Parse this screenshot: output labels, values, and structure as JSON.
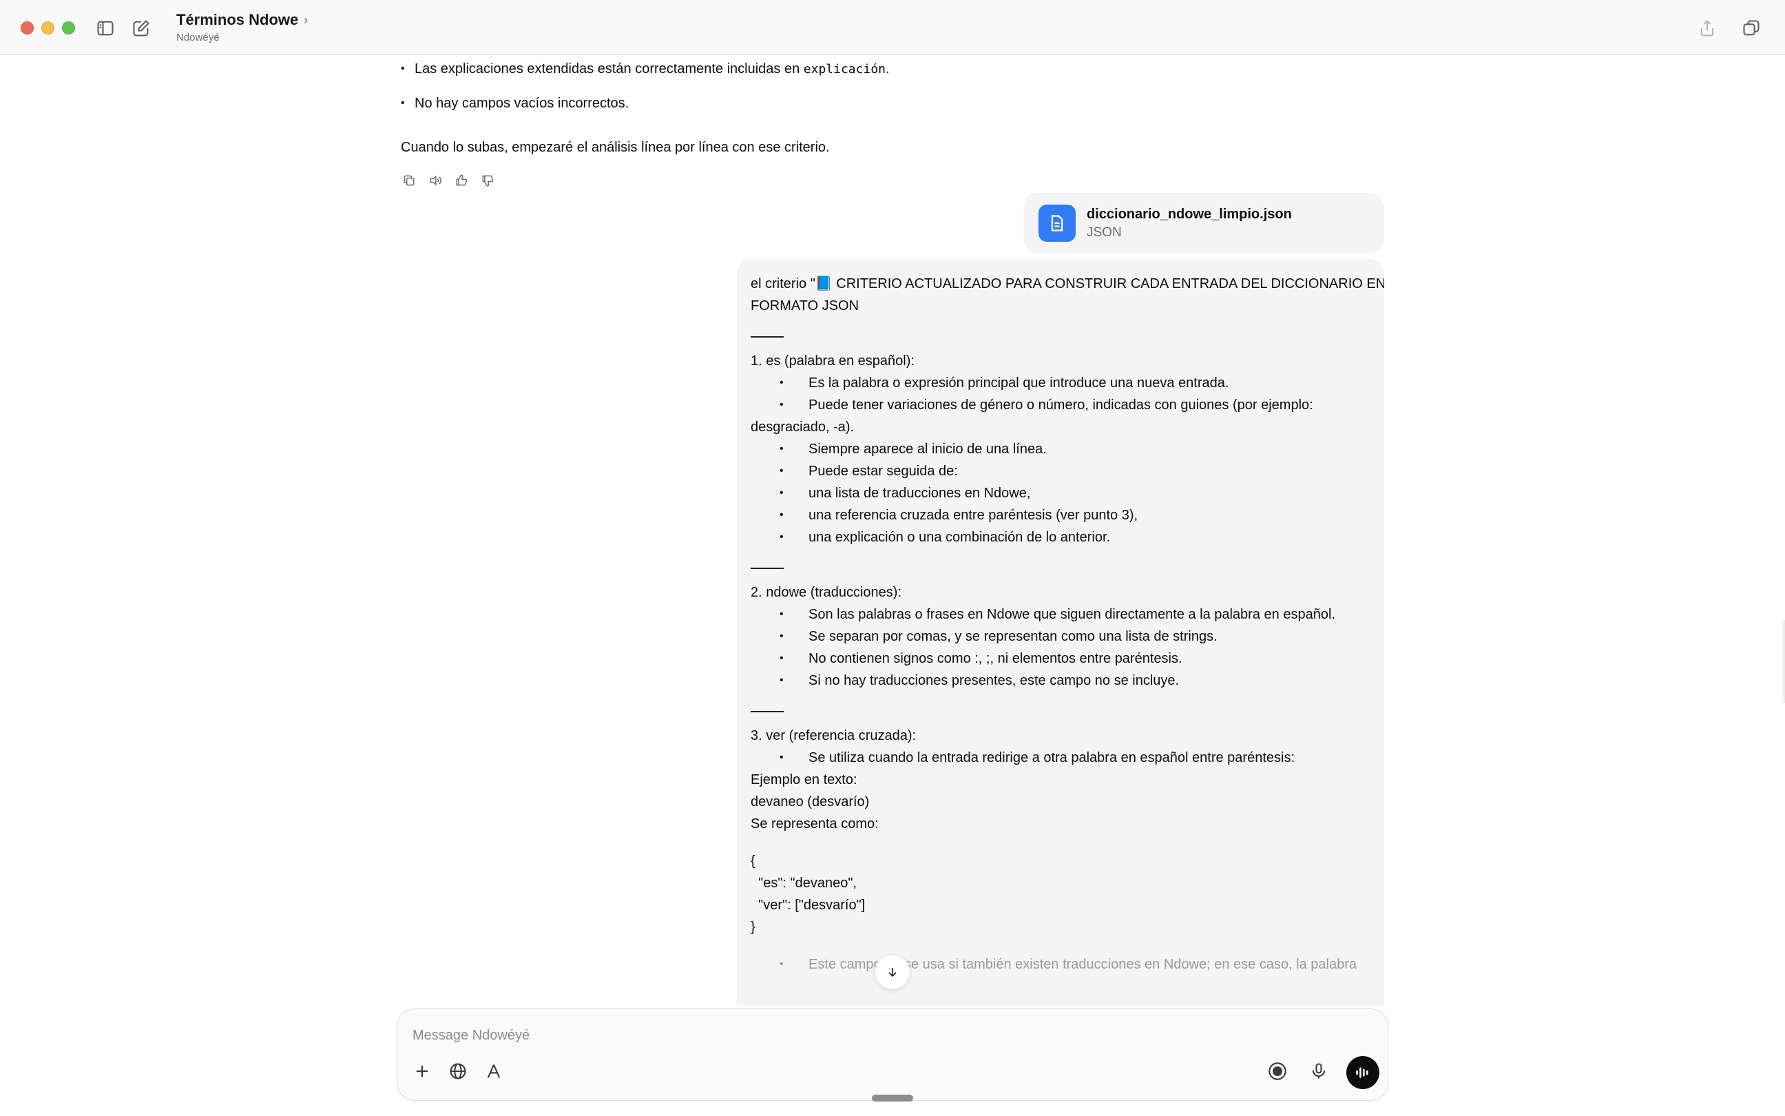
{
  "window": {
    "title": "Términos Ndowe",
    "title_chevron": "›",
    "subtitle": "Ndowéyé"
  },
  "assistant_message": {
    "bullets": [
      {
        "text_before": "Las explicaciones extendidas están correctamente incluidas en ",
        "code": "explicación",
        "text_after": "."
      },
      {
        "text_before": "No hay campos vacíos incorrectos.",
        "code": "",
        "text_after": ""
      }
    ],
    "closing": "Cuando lo subas, empezaré el análisis línea por línea con ese criterio."
  },
  "message_actions": [
    "copy-icon",
    "read-aloud-icon",
    "thumbs-up-icon",
    "thumbs-down-icon"
  ],
  "attachment": {
    "name": "diccionario_ndowe_limpio.json",
    "type": "JSON"
  },
  "user_message": {
    "intro_1": "el criterio \"📘 CRITERIO ACTUALIZADO PARA CONSTRUIR CADA ENTRADA DEL DICCIONARIO EN",
    "intro_2": "FORMATO JSON",
    "s1_title": "1. es (palabra en español):",
    "s1_b1": "Es la palabra o expresión principal que introduce una nueva entrada.",
    "s1_b2": "Puede tener variaciones de género o número, indicadas con guiones (por ejemplo:",
    "s1_b2_cont": "desgraciado, -a).",
    "s1_b3": "Siempre aparece al inicio de una línea.",
    "s1_b4": "Puede estar seguida de:",
    "s1_b5": "una lista de traducciones en Ndowe,",
    "s1_b6": "una referencia cruzada entre paréntesis (ver punto 3),",
    "s1_b7": "una explicación o una combinación de lo anterior.",
    "s2_title": "2. ndowe (traducciones):",
    "s2_b1": "Son las palabras o frases en Ndowe que siguen directamente a la palabra en español.",
    "s2_b2": "Se separan por comas, y se representan como una lista de strings.",
    "s2_b3": "No contienen signos como :, ;, ni elementos entre paréntesis.",
    "s2_b4": "Si no hay traducciones presentes, este campo no se incluye.",
    "s3_title": "3. ver (referencia cruzada):",
    "s3_b1": "Se utiliza cuando la entrada redirige a otra palabra en español entre paréntesis:",
    "s3_ex_label": "Ejemplo en texto:",
    "s3_ex_text": "devaneo (desvarío)",
    "s3_rep_label": "Se representa como:",
    "code_1": "{",
    "code_2": "  \"es\": \"devaneo\",",
    "code_3": "  \"ver\": [\"desvarío\"]",
    "code_4": "}",
    "s3_b2_partial": "Este campo no se usa si también existen traducciones en Ndowe; en ese caso, la palabra"
  },
  "composer": {
    "placeholder": "Message Ndowéyé",
    "tools": [
      "plus-icon",
      "globe-icon",
      "tools-icon"
    ],
    "right_tools": [
      "record-icon",
      "microphone-icon",
      "voice-mode-icon"
    ]
  }
}
